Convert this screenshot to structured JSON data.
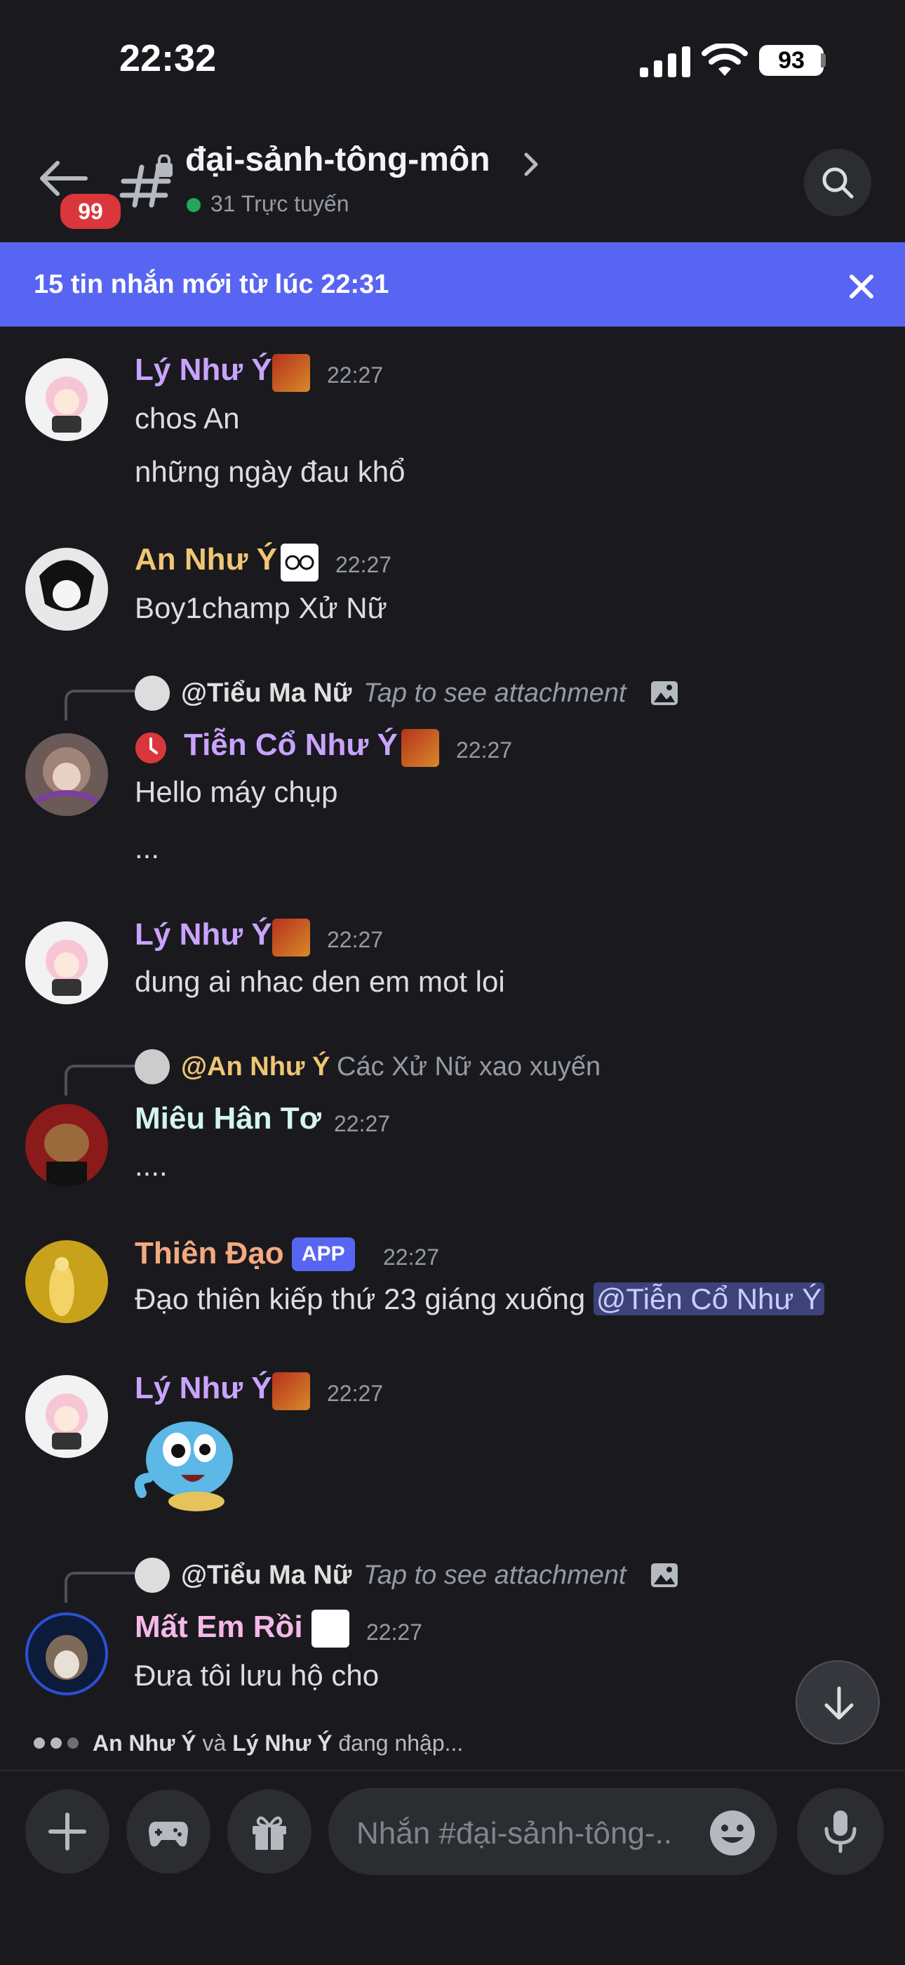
{
  "status_bar": {
    "time": "22:32",
    "battery": "93"
  },
  "header": {
    "unread_count": "99",
    "channel_name": "đại-sảnh-tông-môn",
    "online_status": "31 Trực tuyến"
  },
  "new_messages_bar": {
    "text": "15 tin nhắn mới từ lúc 22:31"
  },
  "messages": [
    {
      "user": "Lý Như Ý",
      "user_color": "#c9a3ff",
      "time": "22:27",
      "lines": [
        "chos  An",
        "những  ngày đau khổ"
      ]
    },
    {
      "user": "An Như Ý",
      "user_color": "#f0c674",
      "time": "22:27",
      "lines": [
        "Boy1champ Xử Nữ"
      ]
    },
    {
      "reply_user": "@Tiểu Ma Nữ",
      "reply_text": "Tap to see attachment",
      "user": "Tiễn Cổ Như Ý",
      "user_color": "#c9a3ff",
      "time": "22:27",
      "lines": [
        "Hello máy chụp",
        "..."
      ]
    },
    {
      "user": "Lý Như Ý",
      "user_color": "#c9a3ff",
      "time": "22:27",
      "lines": [
        "dung  ai nhac den em mot loi"
      ]
    },
    {
      "reply_user": "@An Như Ý",
      "reply_text": "Các Xử Nữ xao xuyến",
      "user": "Miêu Hân Tơ",
      "user_color": "#d4f5e9",
      "time": "22:27",
      "lines": [
        "...."
      ]
    },
    {
      "user": "Thiên Đạo",
      "user_color": "#f5a97f",
      "tag": "APP",
      "time": "22:27",
      "text": "Đạo thiên kiếp thứ 23 giáng xuống",
      "mention": "@Tiễn Cổ Như Ý"
    },
    {
      "user": "Lý Như Ý",
      "user_color": "#c9a3ff",
      "time": "22:27",
      "sticker": "squirtle-sticker"
    },
    {
      "reply_user": "@Tiểu Ma Nữ",
      "reply_text": "Tap to see attachment",
      "user": "Mất Em Rồi",
      "user_color": "#f5b8e8",
      "time": "22:27",
      "lines": [
        "Đưa tôi lưu hộ cho"
      ]
    }
  ],
  "typing": {
    "user1": "An Như Ý",
    "connector": "và",
    "user2": "Lý Như Ý",
    "suffix": "đang nhập..."
  },
  "composer": {
    "placeholder": "Nhắn #đại-sảnh-tông-.."
  },
  "colors": {
    "accent": "#5865f2",
    "background": "#1a1a1e",
    "online": "#23a55a",
    "badge": "#da373c"
  }
}
